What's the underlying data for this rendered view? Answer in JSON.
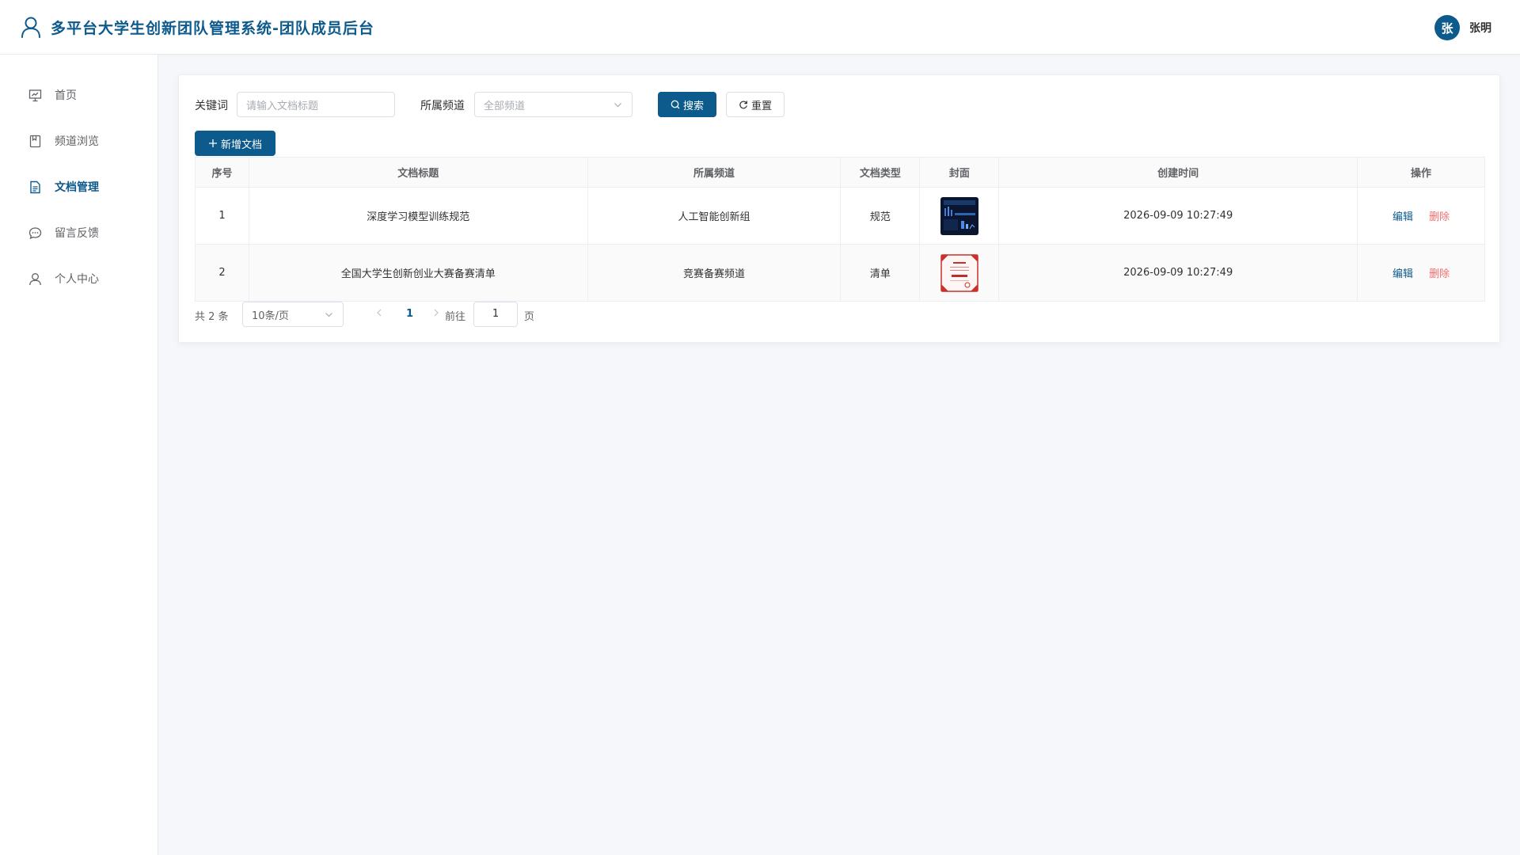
{
  "header": {
    "title": "多平台大学生创新团队管理系统-团队成员后台",
    "avatar_text": "张",
    "user_name": "张明",
    "brand_color": "#0d5a8c"
  },
  "sidebar": {
    "items": [
      {
        "label": "首页",
        "icon": "presentation-icon",
        "active": false
      },
      {
        "label": "频道浏览",
        "icon": "book-icon",
        "active": false
      },
      {
        "label": "文档管理",
        "icon": "document-icon",
        "active": true
      },
      {
        "label": "留言反馈",
        "icon": "chat-icon",
        "active": false
      },
      {
        "label": "个人中心",
        "icon": "user-icon",
        "active": false
      }
    ]
  },
  "filters": {
    "keyword_label": "关键词",
    "keyword_placeholder": "请输入文档标题",
    "channel_label": "所属频道",
    "channel_selected": "全部频道",
    "search_button": "搜索",
    "reset_button": "重置"
  },
  "toolbar": {
    "add_button": "新增文档"
  },
  "table": {
    "columns": [
      "序号",
      "文档标题",
      "所属频道",
      "文档类型",
      "封面",
      "创建时间",
      "操作"
    ],
    "rows": [
      {
        "index": "1",
        "title": "深度学习模型训练规范",
        "channel": "人工智能创新组",
        "type": "规范",
        "cover": "dark-dashboard-thumbnail",
        "created": "2026-09-09 10:27:49",
        "edit": "编辑",
        "delete": "删除"
      },
      {
        "index": "2",
        "title": "全国大学生创新创业大赛备赛清单",
        "channel": "竞赛备赛频道",
        "type": "清单",
        "cover": "red-certificate-thumbnail",
        "created": "2026-09-09 10:27:49",
        "edit": "编辑",
        "delete": "删除"
      }
    ]
  },
  "pagination": {
    "total_text": "共 2 条",
    "page_size": "10条/页",
    "current_page": "1",
    "goto_label": "前往",
    "goto_value": "1",
    "page_unit": "页"
  },
  "colors": {
    "accent": "#0d5a8c",
    "danger": "#f56c6c",
    "background": "#f5f7fa"
  }
}
